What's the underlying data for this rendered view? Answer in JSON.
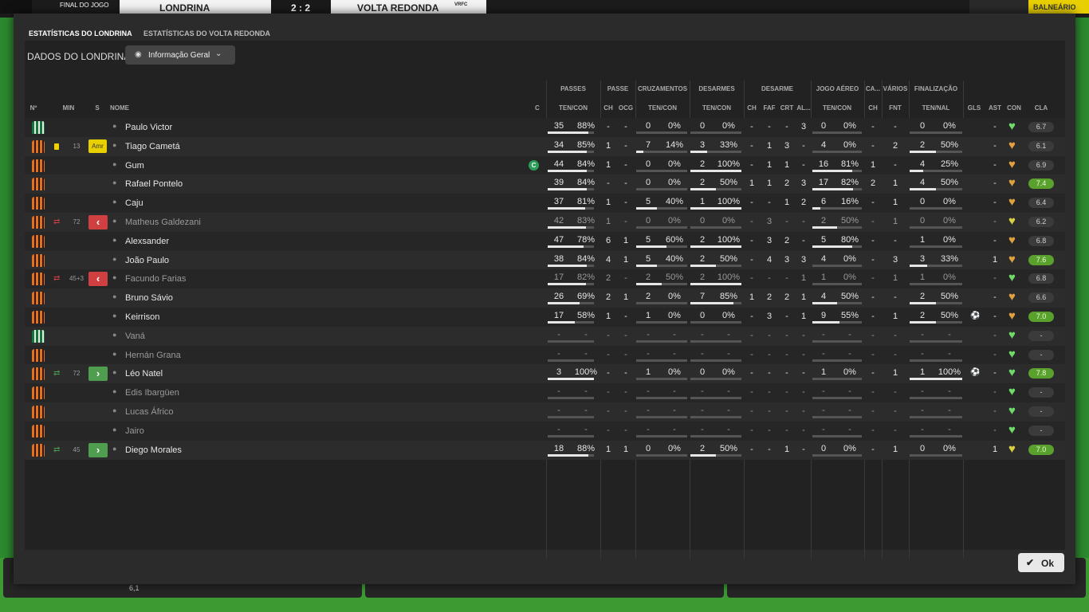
{
  "background": {
    "final_label": "FINAL DO JOGO",
    "home_team": "LONDRINA",
    "score": "2 : 2",
    "away_team": "VOLTA REDONDA",
    "away_badge": "VRFC",
    "right_button": "BALNEÁRIO",
    "bottom_rating": "6,1"
  },
  "tabs": [
    "ESTATÍSTICAS DO LONDRINA",
    "ESTATÍSTICAS DO VOLTA REDONDA"
  ],
  "section_title": "DADOS DO LONDRINA",
  "view_dropdown": "Informação Geral",
  "groups": {
    "passes": "PASSES",
    "passe": "PASSE",
    "cruz": "CRUZAMENTOS",
    "desarmes": "DESARMES",
    "desarme": "DESARME",
    "aereo": "JOGO AÉREO",
    "ca": "CA...",
    "varios": "VÁRIOS",
    "final": "FINALIZAÇÃO"
  },
  "headers": {
    "num": "Nº",
    "min": "MIN",
    "s": "S",
    "nome": "NOME",
    "c": "C",
    "pass": "TEN/CON",
    "passe_ch": "CH",
    "passe_ocg": "OCG",
    "cruz": "TEN/CON",
    "des": "TEN/CON",
    "d_ch": "CH",
    "d_faf": "FAF",
    "d_crt": "CRT",
    "d_al": "AL...",
    "aer": "TEN/CON",
    "ca_ch": "CH",
    "fnt": "FNT",
    "fin": "TEN/NAL",
    "gls": "GLS",
    "ast": "AST",
    "con": "CON",
    "cla": "CLA"
  },
  "rows": [
    {
      "shirt": "green",
      "name": "Paulo Victor",
      "dim": false,
      "min": "",
      "card": false,
      "sub": "",
      "cap": false,
      "pa": "35",
      "pp": "88%",
      "pch": "-",
      "pocg": "-",
      "ca": "0",
      "cp": "0%",
      "da": "0",
      "dp": "0%",
      "dch": "-",
      "faf": "-",
      "crt": "-",
      "al": "3",
      "aa": "0",
      "ap": "0%",
      "cach": "-",
      "fnt": "-",
      "fa": "0",
      "fp": "0%",
      "gls": "",
      "ball": false,
      "ast": "-",
      "heart": "green",
      "cla": "6.7",
      "claColor": "grey",
      "pf": 0.88,
      "cf": 0,
      "df": 0,
      "af": 0,
      "ff": 0
    },
    {
      "shirt": "orange",
      "name": "Tiago Cametá",
      "dim": false,
      "min": "13",
      "card": true,
      "sub": "",
      "cap": false,
      "pa": "34",
      "pp": "85%",
      "pch": "1",
      "pocg": "-",
      "ca": "7",
      "cp": "14%",
      "da": "3",
      "dp": "33%",
      "dch": "-",
      "faf": "1",
      "crt": "3",
      "al": "-",
      "aa": "4",
      "ap": "0%",
      "cach": "-",
      "fnt": "2",
      "fa": "2",
      "fp": "50%",
      "gls": "",
      "ball": false,
      "ast": "-",
      "heart": "orange",
      "cla": "6.1",
      "claColor": "grey",
      "pf": 0.85,
      "cf": 0.14,
      "df": 0.33,
      "af": 0,
      "ff": 0.5
    },
    {
      "shirt": "orange",
      "name": "Gum",
      "dim": false,
      "min": "",
      "card": false,
      "sub": "",
      "cap": true,
      "pa": "44",
      "pp": "84%",
      "pch": "1",
      "pocg": "-",
      "ca": "0",
      "cp": "0%",
      "da": "2",
      "dp": "100%",
      "dch": "-",
      "faf": "1",
      "crt": "1",
      "al": "-",
      "aa": "16",
      "ap": "81%",
      "cach": "1",
      "fnt": "-",
      "fa": "4",
      "fp": "25%",
      "gls": "",
      "ball": false,
      "ast": "-",
      "heart": "orange",
      "cla": "6.9",
      "claColor": "grey",
      "pf": 0.84,
      "cf": 0,
      "df": 1,
      "af": 0.81,
      "ff": 0.25
    },
    {
      "shirt": "orange",
      "name": "Rafael Pontelo",
      "dim": false,
      "min": "",
      "card": false,
      "sub": "",
      "cap": false,
      "pa": "39",
      "pp": "84%",
      "pch": "-",
      "pocg": "-",
      "ca": "0",
      "cp": "0%",
      "da": "2",
      "dp": "50%",
      "dch": "1",
      "faf": "1",
      "crt": "2",
      "al": "3",
      "aa": "17",
      "ap": "82%",
      "cach": "2",
      "fnt": "1",
      "fa": "4",
      "fp": "50%",
      "gls": "",
      "ball": false,
      "ast": "-",
      "heart": "orange",
      "cla": "7.4",
      "claColor": "green",
      "pf": 0.84,
      "cf": 0,
      "df": 0.5,
      "af": 0.82,
      "ff": 0.5
    },
    {
      "shirt": "orange",
      "name": "Caju",
      "dim": false,
      "min": "",
      "card": false,
      "sub": "",
      "cap": false,
      "pa": "37",
      "pp": "81%",
      "pch": "1",
      "pocg": "-",
      "ca": "5",
      "cp": "40%",
      "da": "1",
      "dp": "100%",
      "dch": "-",
      "faf": "-",
      "crt": "1",
      "al": "2",
      "aa": "6",
      "ap": "16%",
      "cach": "-",
      "fnt": "1",
      "fa": "0",
      "fp": "0%",
      "gls": "",
      "ball": false,
      "ast": "-",
      "heart": "orange",
      "cla": "6.4",
      "claColor": "grey",
      "pf": 0.81,
      "cf": 0.4,
      "df": 1,
      "af": 0.16,
      "ff": 0
    },
    {
      "shirt": "orange",
      "name": "Matheus Galdezani",
      "dim": true,
      "min": "72",
      "card": false,
      "sub": "out",
      "cap": false,
      "pa": "42",
      "pp": "83%",
      "pch": "1",
      "pocg": "-",
      "ca": "0",
      "cp": "0%",
      "da": "0",
      "dp": "0%",
      "dch": "-",
      "faf": "3",
      "crt": "-",
      "al": "-",
      "aa": "2",
      "ap": "50%",
      "cach": "-",
      "fnt": "1",
      "fa": "0",
      "fp": "0%",
      "gls": "",
      "ball": false,
      "ast": "-",
      "heart": "yellow",
      "cla": "6.2",
      "claColor": "grey",
      "pf": 0.83,
      "cf": 0,
      "df": 0,
      "af": 0.5,
      "ff": 0
    },
    {
      "shirt": "orange",
      "name": "Alexsander",
      "dim": false,
      "min": "",
      "card": false,
      "sub": "",
      "cap": false,
      "pa": "47",
      "pp": "78%",
      "pch": "6",
      "pocg": "1",
      "ca": "5",
      "cp": "60%",
      "da": "2",
      "dp": "100%",
      "dch": "-",
      "faf": "3",
      "crt": "2",
      "al": "-",
      "aa": "5",
      "ap": "80%",
      "cach": "-",
      "fnt": "-",
      "fa": "1",
      "fp": "0%",
      "gls": "",
      "ball": false,
      "ast": "-",
      "heart": "orange",
      "cla": "6.8",
      "claColor": "grey",
      "pf": 0.78,
      "cf": 0.6,
      "df": 1,
      "af": 0.8,
      "ff": 0
    },
    {
      "shirt": "orange",
      "name": "João Paulo",
      "dim": false,
      "min": "",
      "card": false,
      "sub": "",
      "cap": false,
      "pa": "38",
      "pp": "84%",
      "pch": "4",
      "pocg": "1",
      "ca": "5",
      "cp": "40%",
      "da": "2",
      "dp": "50%",
      "dch": "-",
      "faf": "4",
      "crt": "3",
      "al": "3",
      "aa": "4",
      "ap": "0%",
      "cach": "-",
      "fnt": "3",
      "fa": "3",
      "fp": "33%",
      "gls": "",
      "ball": false,
      "ast": "1",
      "heart": "orange",
      "cla": "7.6",
      "claColor": "green",
      "pf": 0.84,
      "cf": 0.4,
      "df": 0.5,
      "af": 0,
      "ff": 0.33
    },
    {
      "shirt": "orange",
      "name": "Facundo Farias",
      "dim": true,
      "min": "45+3",
      "card": false,
      "sub": "out",
      "cap": false,
      "pa": "17",
      "pp": "82%",
      "pch": "2",
      "pocg": "-",
      "ca": "2",
      "cp": "50%",
      "da": "2",
      "dp": "100%",
      "dch": "-",
      "faf": "-",
      "crt": "-",
      "al": "1",
      "aa": "1",
      "ap": "0%",
      "cach": "-",
      "fnt": "1",
      "fa": "1",
      "fp": "0%",
      "gls": "",
      "ball": false,
      "ast": "-",
      "heart": "green",
      "cla": "6.8",
      "claColor": "grey",
      "pf": 0.82,
      "cf": 0.5,
      "df": 1,
      "af": 0,
      "ff": 0
    },
    {
      "shirt": "orange",
      "name": "Bruno Sávio",
      "dim": false,
      "min": "",
      "card": false,
      "sub": "",
      "cap": false,
      "pa": "26",
      "pp": "69%",
      "pch": "2",
      "pocg": "1",
      "ca": "2",
      "cp": "0%",
      "da": "7",
      "dp": "85%",
      "dch": "1",
      "faf": "2",
      "crt": "2",
      "al": "1",
      "aa": "4",
      "ap": "50%",
      "cach": "-",
      "fnt": "-",
      "fa": "2",
      "fp": "50%",
      "gls": "",
      "ball": false,
      "ast": "-",
      "heart": "orange",
      "cla": "6.6",
      "claColor": "grey",
      "pf": 0.69,
      "cf": 0,
      "df": 0.85,
      "af": 0.5,
      "ff": 0.5
    },
    {
      "shirt": "orange",
      "name": "Keirrison",
      "dim": false,
      "min": "",
      "card": false,
      "sub": "",
      "cap": false,
      "pa": "17",
      "pp": "58%",
      "pch": "1",
      "pocg": "-",
      "ca": "1",
      "cp": "0%",
      "da": "0",
      "dp": "0%",
      "dch": "-",
      "faf": "3",
      "crt": "-",
      "al": "1",
      "aa": "9",
      "ap": "55%",
      "cach": "-",
      "fnt": "1",
      "fa": "2",
      "fp": "50%",
      "gls": "",
      "ball": true,
      "ast": "-",
      "heart": "orange",
      "cla": "7.0",
      "claColor": "green",
      "pf": 0.58,
      "cf": 0,
      "df": 0,
      "af": 0.55,
      "ff": 0.5
    },
    {
      "shirt": "green",
      "name": "Vaná",
      "dim": true,
      "min": "",
      "card": false,
      "sub": "",
      "cap": false,
      "pa": "-",
      "pp": "-",
      "pch": "-",
      "pocg": "-",
      "ca": "-",
      "cp": "-",
      "da": "-",
      "dp": "-",
      "dch": "-",
      "faf": "-",
      "crt": "-",
      "al": "-",
      "aa": "-",
      "ap": "-",
      "cach": "-",
      "fnt": "-",
      "fa": "-",
      "fp": "-",
      "gls": "",
      "ball": false,
      "ast": "-",
      "heart": "green",
      "cla": "-",
      "claColor": "grey",
      "pf": 0,
      "cf": 0,
      "df": 0,
      "af": 0,
      "ff": 0
    },
    {
      "shirt": "orange",
      "name": "Hernán Grana",
      "dim": true,
      "min": "",
      "card": false,
      "sub": "",
      "cap": false,
      "pa": "-",
      "pp": "-",
      "pch": "-",
      "pocg": "-",
      "ca": "-",
      "cp": "-",
      "da": "-",
      "dp": "-",
      "dch": "-",
      "faf": "-",
      "crt": "-",
      "al": "-",
      "aa": "-",
      "ap": "-",
      "cach": "-",
      "fnt": "-",
      "fa": "-",
      "fp": "-",
      "gls": "",
      "ball": false,
      "ast": "-",
      "heart": "green",
      "cla": "-",
      "claColor": "grey",
      "pf": 0,
      "cf": 0,
      "df": 0,
      "af": 0,
      "ff": 0
    },
    {
      "shirt": "orange",
      "name": "Léo Natel",
      "dim": false,
      "min": "72",
      "card": false,
      "sub": "in",
      "cap": false,
      "pa": "3",
      "pp": "100%",
      "pch": "-",
      "pocg": "-",
      "ca": "1",
      "cp": "0%",
      "da": "0",
      "dp": "0%",
      "dch": "-",
      "faf": "-",
      "crt": "-",
      "al": "-",
      "aa": "1",
      "ap": "0%",
      "cach": "-",
      "fnt": "1",
      "fa": "1",
      "fp": "100%",
      "gls": "",
      "ball": true,
      "ast": "-",
      "heart": "green",
      "cla": "7.8",
      "claColor": "green",
      "pf": 1,
      "cf": 0,
      "df": 0,
      "af": 0,
      "ff": 1
    },
    {
      "shirt": "orange",
      "name": "Edis Ibargüen",
      "dim": true,
      "min": "",
      "card": false,
      "sub": "",
      "cap": false,
      "pa": "-",
      "pp": "-",
      "pch": "-",
      "pocg": "-",
      "ca": "-",
      "cp": "-",
      "da": "-",
      "dp": "-",
      "dch": "-",
      "faf": "-",
      "crt": "-",
      "al": "-",
      "aa": "-",
      "ap": "-",
      "cach": "-",
      "fnt": "-",
      "fa": "-",
      "fp": "-",
      "gls": "",
      "ball": false,
      "ast": "-",
      "heart": "green",
      "cla": "-",
      "claColor": "grey",
      "pf": 0,
      "cf": 0,
      "df": 0,
      "af": 0,
      "ff": 0
    },
    {
      "shirt": "orange",
      "name": "Lucas Áfrico",
      "dim": true,
      "min": "",
      "card": false,
      "sub": "",
      "cap": false,
      "pa": "-",
      "pp": "-",
      "pch": "-",
      "pocg": "-",
      "ca": "-",
      "cp": "-",
      "da": "-",
      "dp": "-",
      "dch": "-",
      "faf": "-",
      "crt": "-",
      "al": "-",
      "aa": "-",
      "ap": "-",
      "cach": "-",
      "fnt": "-",
      "fa": "-",
      "fp": "-",
      "gls": "",
      "ball": false,
      "ast": "-",
      "heart": "green",
      "cla": "-",
      "claColor": "grey",
      "pf": 0,
      "cf": 0,
      "df": 0,
      "af": 0,
      "ff": 0
    },
    {
      "shirt": "orange",
      "name": "Jairo",
      "dim": true,
      "min": "",
      "card": false,
      "sub": "",
      "cap": false,
      "pa": "-",
      "pp": "-",
      "pch": "-",
      "pocg": "-",
      "ca": "-",
      "cp": "-",
      "da": "-",
      "dp": "-",
      "dch": "-",
      "faf": "-",
      "crt": "-",
      "al": "-",
      "aa": "-",
      "ap": "-",
      "cach": "-",
      "fnt": "-",
      "fa": "-",
      "fp": "-",
      "gls": "",
      "ball": false,
      "ast": "-",
      "heart": "green",
      "cla": "-",
      "claColor": "grey",
      "pf": 0,
      "cf": 0,
      "df": 0,
      "af": 0,
      "ff": 0
    },
    {
      "shirt": "orange",
      "name": "Diego Morales",
      "dim": false,
      "min": "45",
      "card": false,
      "sub": "in",
      "cap": false,
      "pa": "18",
      "pp": "88%",
      "pch": "1",
      "pocg": "1",
      "ca": "0",
      "cp": "0%",
      "da": "2",
      "dp": "50%",
      "dch": "-",
      "faf": "-",
      "crt": "1",
      "al": "-",
      "aa": "0",
      "ap": "0%",
      "cach": "-",
      "fnt": "1",
      "fa": "0",
      "fp": "0%",
      "gls": "",
      "ball": false,
      "ast": "1",
      "heart": "yellow",
      "cla": "7.0",
      "claColor": "green",
      "pf": 0.88,
      "cf": 0,
      "df": 0.5,
      "af": 0,
      "ff": 0
    }
  ],
  "card_label": "Amr",
  "captain_mark": "C",
  "ok_button": "Ok",
  "colors": {
    "accent": "#5a9bd5",
    "good": "#5aa02c",
    "card": "#e8d000",
    "sub_out": "#d04040",
    "sub_in": "#4f9d4f",
    "shirt_orange": "#e8701c",
    "shirt_green": "#15753a"
  }
}
